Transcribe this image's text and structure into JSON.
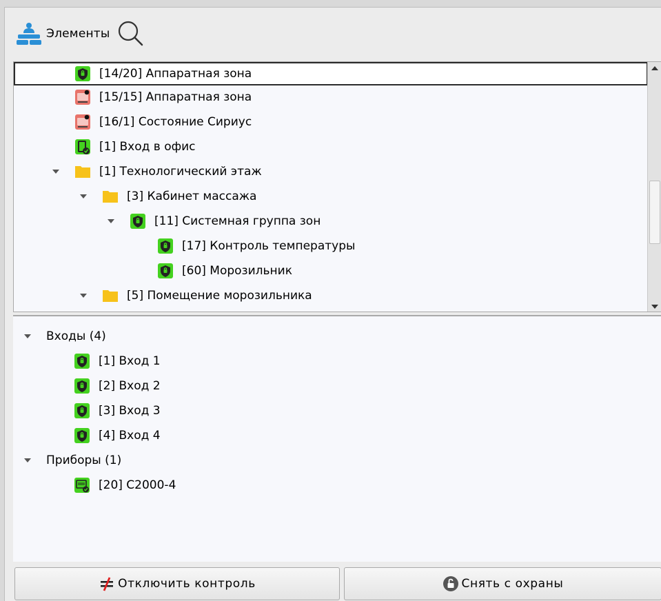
{
  "header": {
    "title": "Элементы"
  },
  "top_tree": {
    "rows": [
      {
        "label": "[14/20] Аппаратная зона",
        "icon": "zone-shield-icon"
      },
      {
        "label": "[15/15] Аппаратная зона",
        "icon": "zone-alarm-icon"
      },
      {
        "label": "[16/1] Состояние Сириус",
        "icon": "zone-alarm-icon"
      },
      {
        "label": "[1] Вход в офис",
        "icon": "door-ok-icon"
      },
      {
        "label": "[1] Технологический этаж",
        "icon": "folder-icon"
      },
      {
        "label": "[3] Кабинет массажа",
        "icon": "folder-icon"
      },
      {
        "label": "[11] Системная группа зон",
        "icon": "zone-shield-icon"
      },
      {
        "label": "[17] Контроль температуры",
        "icon": "zone-shield-icon"
      },
      {
        "label": "[60] Морозильник",
        "icon": "zone-shield-icon"
      },
      {
        "label": "[5] Помещение морозильника",
        "icon": "folder-icon"
      }
    ]
  },
  "bottom_tree": {
    "groups": [
      {
        "label": "Входы (4)"
      },
      {
        "label": "Приборы (1)"
      }
    ],
    "items": [
      {
        "label": "[1] Вход 1",
        "icon": "zone-shield-icon"
      },
      {
        "label": "[2] Вход 2",
        "icon": "zone-shield-icon"
      },
      {
        "label": "[3] Вход 3",
        "icon": "zone-shield-icon"
      },
      {
        "label": "[4] Вход 4",
        "icon": "zone-shield-icon"
      },
      {
        "label": "[20] С2000-4",
        "icon": "device-ok-icon"
      }
    ]
  },
  "buttons": {
    "disable_control": "Отключить контроль",
    "disarm": "Снять с охраны"
  },
  "colors": {
    "status_green": "#44d11f",
    "alarm_red": "#e8736a",
    "folder_yellow": "#f7c21a",
    "logo_blue": "#2a8fd6"
  }
}
